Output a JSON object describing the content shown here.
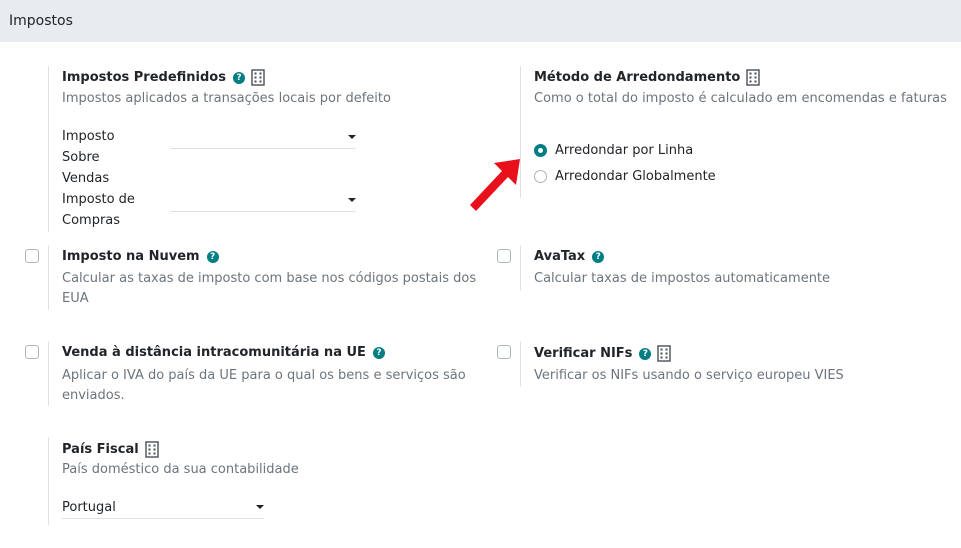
{
  "section": {
    "title": "Impostos"
  },
  "predefined": {
    "title": "Impostos Predefinidos",
    "description": "Impostos aplicados a transações locais por defeito",
    "sales_label_1": "Imposto",
    "sales_label_2": "Sobre",
    "sales_label_3": "Vendas",
    "sales_value": "",
    "purchase_label_1": "Imposto de",
    "purchase_label_2": "Compras",
    "purchase_value": ""
  },
  "rounding": {
    "title": "Método de Arredondamento",
    "description": "Como o total do imposto é calculado em encomendas e faturas",
    "options": [
      {
        "label": "Arredondar por Linha",
        "selected": true
      },
      {
        "label": "Arredondar Globalmente",
        "selected": false
      }
    ]
  },
  "cloud_tax": {
    "title": "Imposto na Nuvem",
    "description_1": "Calcular as taxas de imposto com base nos códigos postais dos",
    "description_2": "EUA",
    "checked": false
  },
  "avatax": {
    "title": "AvaTax",
    "description": "Calcular taxas de impostos automaticamente",
    "checked": false
  },
  "distance_sale": {
    "title": "Venda à distância intracomunitária na UE",
    "description_1": "Aplicar o IVA do país da UE para o qual os bens e serviços são",
    "description_2": "enviados.",
    "checked": false
  },
  "vies": {
    "title": "Verificar NIFs",
    "description": "Verificar os NIFs usando o serviço europeu VIES",
    "checked": false
  },
  "fiscal_country": {
    "title": "País Fiscal",
    "description": "País doméstico da sua contabilidade",
    "value": "Portugal"
  },
  "icons": {
    "help": "question-circle-icon",
    "company": "building-icon",
    "annotation": "red-arrow-icon"
  },
  "colors": {
    "accent": "#017e84",
    "arrow": "#e8101b",
    "header_bg": "#e9ecef"
  }
}
